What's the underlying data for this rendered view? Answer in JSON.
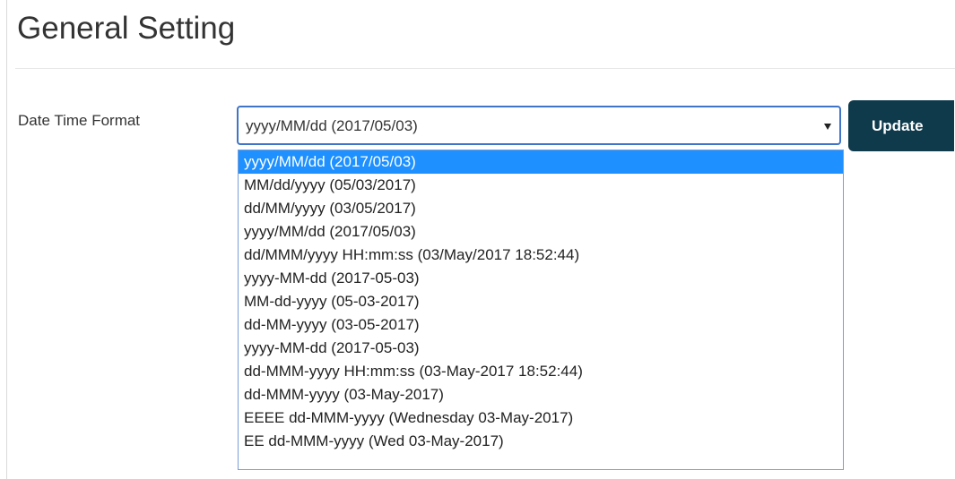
{
  "page": {
    "title": "General Setting"
  },
  "form": {
    "date_time_format": {
      "label": "Date Time Format",
      "selected_value": "yyyy/MM/dd (2017/05/03)",
      "highlighted_index": 0,
      "options": [
        "yyyy/MM/dd (2017/05/03)",
        "MM/dd/yyyy (05/03/2017)",
        "dd/MM/yyyy (03/05/2017)",
        "yyyy/MM/dd (2017/05/03)",
        "dd/MMM/yyyy HH:mm:ss (03/May/2017 18:52:44)",
        "yyyy-MM-dd (2017-05-03)",
        "MM-dd-yyyy (05-03-2017)",
        "dd-MM-yyyy (03-05-2017)",
        "yyyy-MM-dd (2017-05-03)",
        "dd-MMM-yyyy HH:mm:ss (03-May-2017 18:52:44)",
        "dd-MMM-yyyy (03-May-2017)",
        "EEEE dd-MMM-yyyy (Wednesday 03-May-2017)",
        "EE dd-MMM-yyyy (Wed 03-May-2017)"
      ]
    },
    "update_label": "Update"
  },
  "colors": {
    "update_button_bg": "#0e3a4c",
    "select_focus_border": "#3f74c8",
    "option_highlight_bg": "#1e90ff"
  },
  "icons": {
    "select_caret": "triangle-down-icon"
  }
}
